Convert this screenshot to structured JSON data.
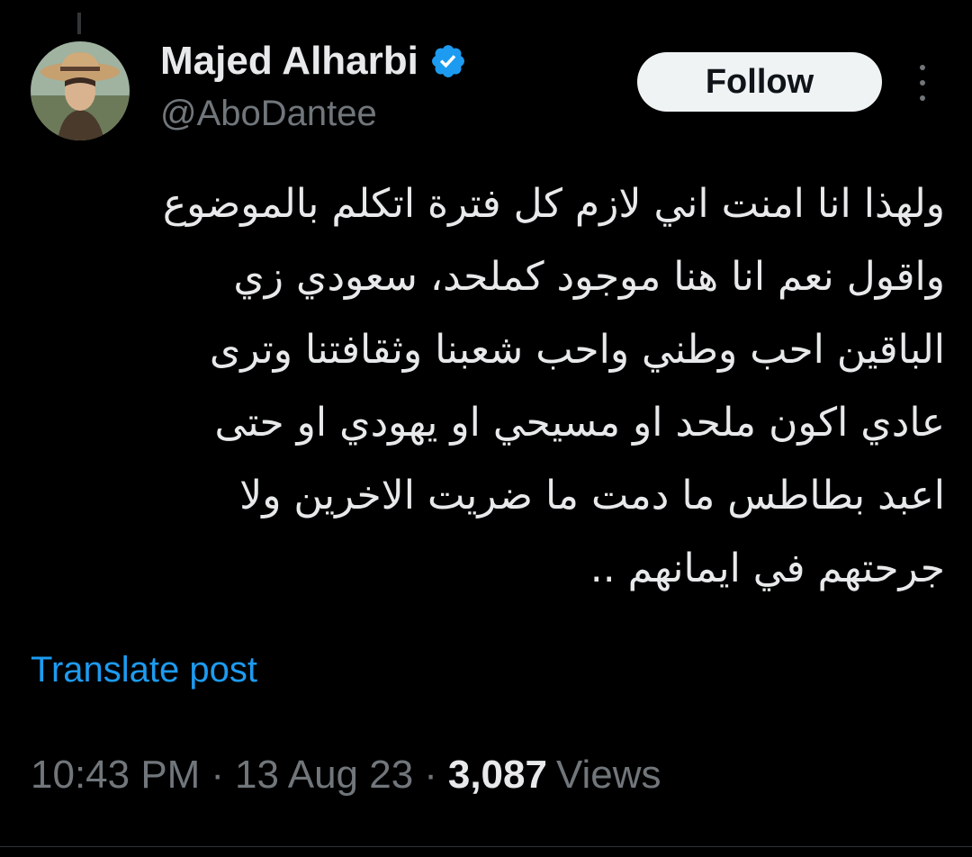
{
  "author": {
    "display_name": "Majed Alharbi",
    "handle": "@AboDantee",
    "verified": true,
    "verified_color": "#1d9bf0",
    "avatar_icon": "profile-photo-cowboy-hat"
  },
  "actions": {
    "follow_label": "Follow",
    "more_icon": "more-vertical-icon"
  },
  "tweet": {
    "lines": [
      "ولهذا انا امنت اني لازم كل فترة اتكلم بالموضوع",
      "واقول نعم انا هنا موجود كملحد، سعودي زي",
      "الباقين احب وطني واحب شعبنا وثقافتنا وترى",
      "عادي اكون ملحد او مسيحي او يهودي او حتى",
      "اعبد بطاطس ما دمت ما ضريت الاخرين ولا",
      "جرحتهم في ايمانهم .."
    ],
    "translate_label": "Translate post"
  },
  "meta": {
    "time": "10:43 PM",
    "separator": "·",
    "date": "13 Aug 23",
    "views_count": "3,087",
    "views_label": "Views"
  }
}
